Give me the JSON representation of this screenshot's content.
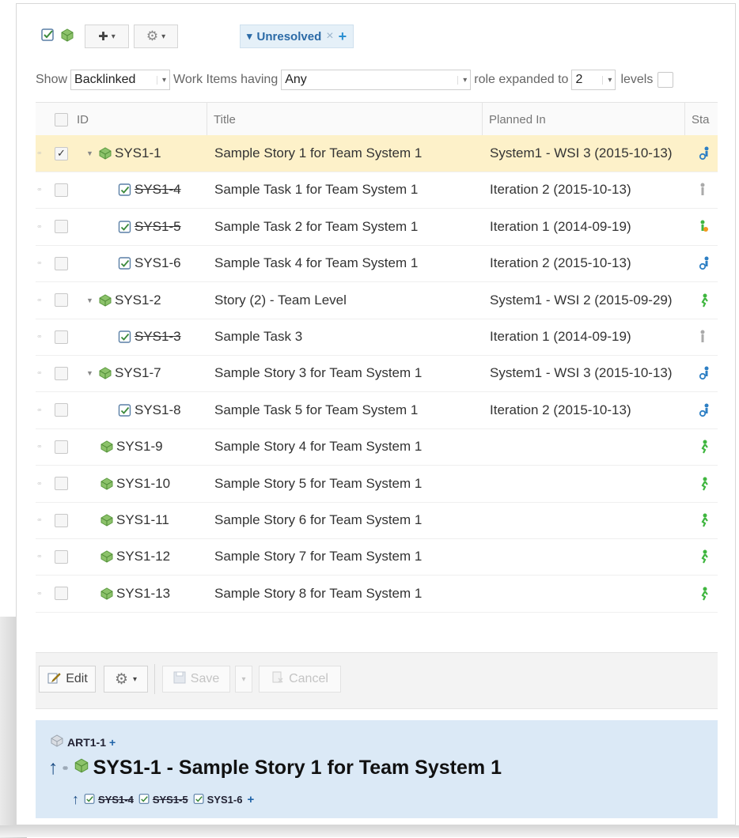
{
  "toolbar": {
    "add_label": "✚",
    "gear_label": "⚙",
    "dropdown_caret": "▾",
    "filter": {
      "label": "Unresolved",
      "remove": "×",
      "add": "+"
    }
  },
  "show_row": {
    "show_label": "Show",
    "show_value": "Backlinked",
    "work_items_label": "Work Items having",
    "role_value": "Any",
    "role_expanded_label": "role expanded to",
    "levels_value": "2",
    "levels_label": "levels"
  },
  "table": {
    "headers": {
      "id": "ID",
      "title": "Title",
      "planned_in": "Planned In",
      "status": "Sta"
    },
    "rows": [
      {
        "id": "SYS1-1",
        "type": "story",
        "level": 0,
        "twisty": true,
        "checked": true,
        "struck": false,
        "title": "Sample Story 1 for Team System 1",
        "planned": "System1 - WSI 3 (2015-10-13)",
        "status_icon": "in-progress-icon",
        "selected": true
      },
      {
        "id": "SYS1-4",
        "type": "task",
        "level": 1,
        "twisty": false,
        "checked": false,
        "struck": true,
        "title": "Sample Task 1 for Team System 1",
        "planned": "Iteration 2 (2015-10-13)",
        "status_icon": "done-icon"
      },
      {
        "id": "SYS1-5",
        "type": "task",
        "level": 1,
        "twisty": false,
        "checked": false,
        "struck": true,
        "title": "Sample Task 2 for Team System 1",
        "planned": "Iteration 1 (2014-09-19)",
        "status_icon": "review-icon"
      },
      {
        "id": "SYS1-6",
        "type": "task",
        "level": 1,
        "twisty": false,
        "checked": false,
        "struck": false,
        "title": "Sample Task 4 for Team System 1",
        "planned": "Iteration 2 (2015-10-13)",
        "status_icon": "in-progress-icon"
      },
      {
        "id": "SYS1-2",
        "type": "story",
        "level": 0,
        "twisty": true,
        "checked": false,
        "struck": false,
        "title": "Story (2) - Team Level",
        "planned": "System1 - WSI 2 (2015-09-29)",
        "status_icon": "open-icon"
      },
      {
        "id": "SYS1-3",
        "type": "task",
        "level": 1,
        "twisty": false,
        "checked": false,
        "struck": true,
        "title": "Sample Task 3",
        "planned": "Iteration 1 (2014-09-19)",
        "status_icon": "done-icon"
      },
      {
        "id": "SYS1-7",
        "type": "story",
        "level": 0,
        "twisty": true,
        "checked": false,
        "struck": false,
        "title": "Sample Story 3 for Team System 1",
        "planned": "System1 - WSI 3 (2015-10-13)",
        "status_icon": "in-progress-icon"
      },
      {
        "id": "SYS1-8",
        "type": "task",
        "level": 1,
        "twisty": false,
        "checked": false,
        "struck": false,
        "title": "Sample Task 5 for Team System 1",
        "planned": "Iteration 2 (2015-10-13)",
        "status_icon": "in-progress-icon"
      },
      {
        "id": "SYS1-9",
        "type": "story",
        "level": 0,
        "twisty": false,
        "checked": false,
        "struck": false,
        "title": "Sample Story 4 for Team System 1",
        "planned": "",
        "status_icon": "open-icon"
      },
      {
        "id": "SYS1-10",
        "type": "story",
        "level": 0,
        "twisty": false,
        "checked": false,
        "struck": false,
        "title": "Sample Story 5 for Team System 1",
        "planned": "",
        "status_icon": "open-icon"
      },
      {
        "id": "SYS1-11",
        "type": "story",
        "level": 0,
        "twisty": false,
        "checked": false,
        "struck": false,
        "title": "Sample Story 6 for Team System 1",
        "planned": "",
        "status_icon": "open-icon"
      },
      {
        "id": "SYS1-12",
        "type": "story",
        "level": 0,
        "twisty": false,
        "checked": false,
        "struck": false,
        "title": "Sample Story 7 for Team System 1",
        "planned": "",
        "status_icon": "open-icon"
      },
      {
        "id": "SYS1-13",
        "type": "story",
        "level": 0,
        "twisty": false,
        "checked": false,
        "struck": false,
        "title": "Sample Story 8 for Team System 1",
        "planned": "",
        "status_icon": "open-icon"
      }
    ]
  },
  "bottom_toolbar": {
    "edit_label": "Edit",
    "save_label": "Save",
    "cancel_label": "Cancel"
  },
  "detail": {
    "parent_id": "ART1-1",
    "title": "SYS1-1 - Sample Story 1 for Team System 1",
    "children": [
      {
        "id": "SYS1-4",
        "struck": true
      },
      {
        "id": "SYS1-5",
        "struck": true
      },
      {
        "id": "SYS1-6",
        "struck": false
      }
    ]
  },
  "colors": {
    "selected_row": "#fdf1c9",
    "detail_bg": "#dbe9f6",
    "filter_text": "#2b6aa6",
    "accent_blue": "#1f63a8"
  }
}
